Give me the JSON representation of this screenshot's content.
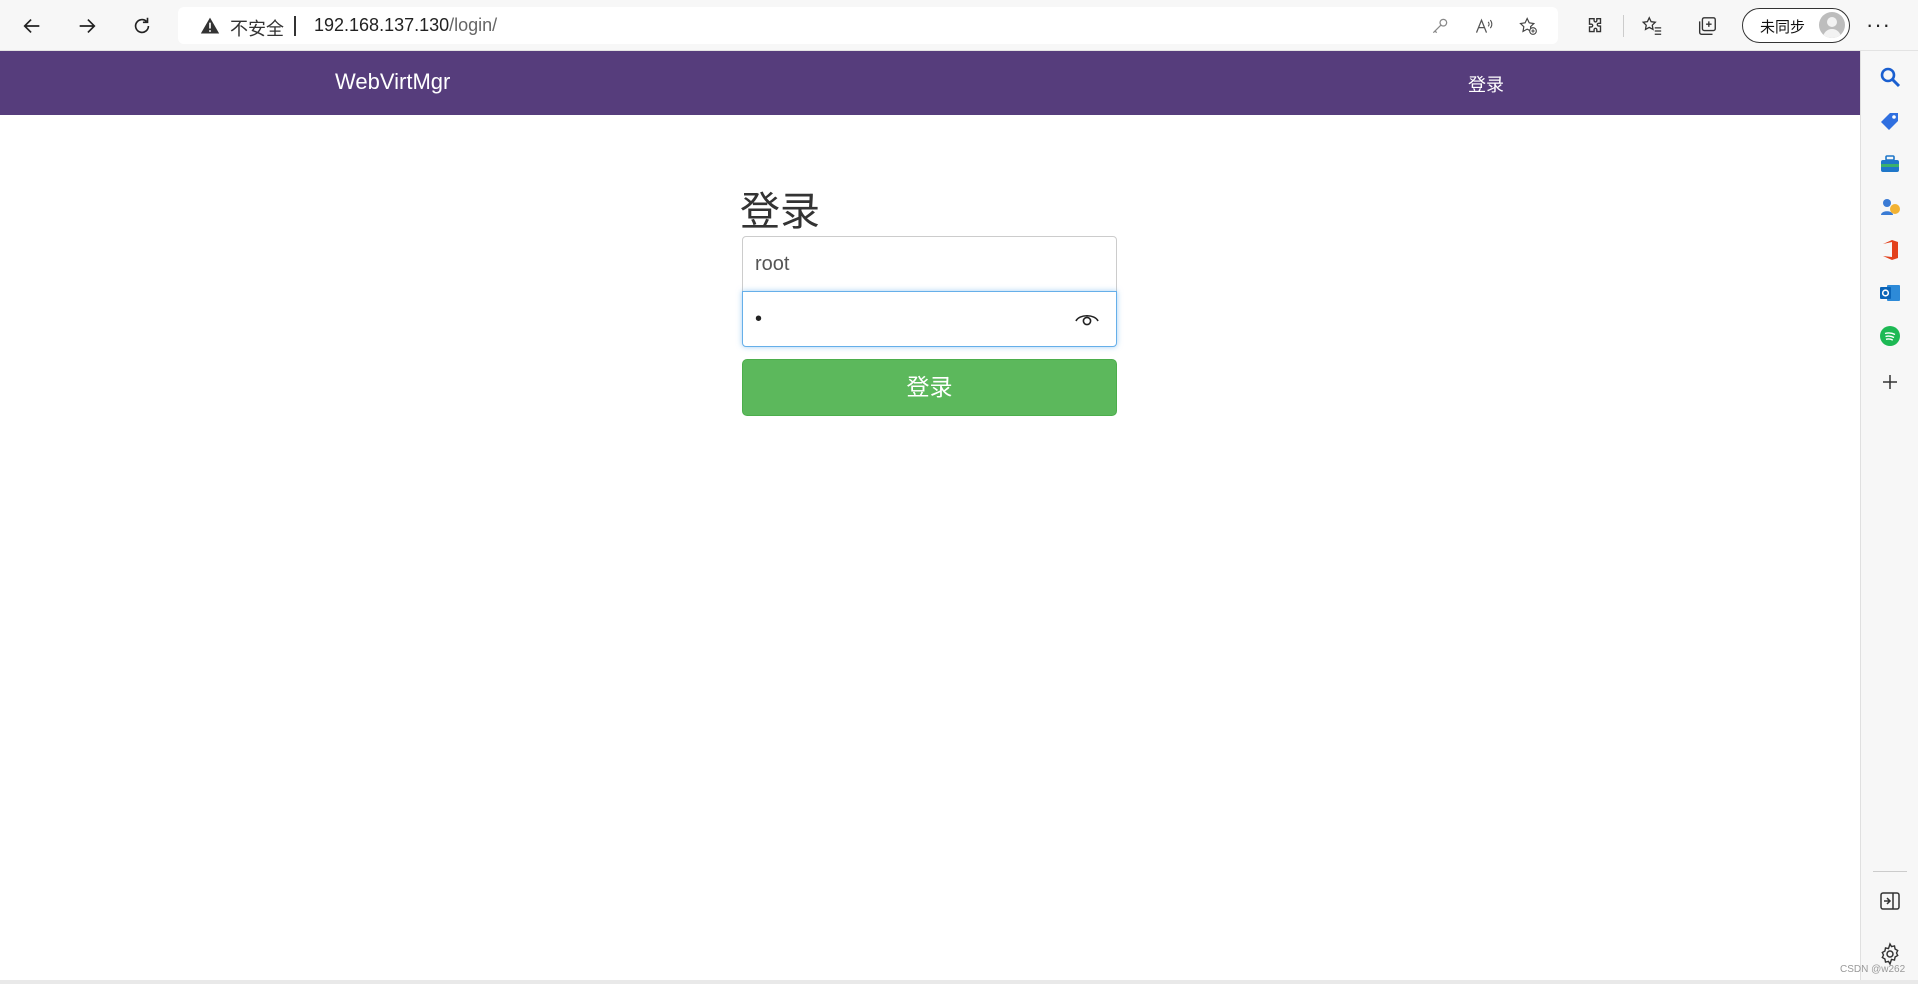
{
  "browser": {
    "address": {
      "security_label": "不安全",
      "url_host": "192.168.137.130",
      "url_path": "/login/"
    },
    "profile_label": "未同步",
    "more_label": "···"
  },
  "navbar": {
    "brand": "WebVirtMgr",
    "login_link": "登录"
  },
  "login": {
    "title": "登录",
    "username_value": "root",
    "password_mask": "•",
    "submit_label": "登录"
  },
  "colors": {
    "navbar": "#563d7c",
    "button": "#5cb85c",
    "focus": "#66afe9"
  },
  "sidebar": {
    "icons": [
      "search-icon",
      "shopping-tag-icon",
      "toolbox-icon",
      "games-icon",
      "office-icon",
      "outlook-icon",
      "spotify-icon",
      "add-icon",
      "split-screen-icon",
      "settings-icon"
    ]
  },
  "watermark": "CSDN @w262"
}
